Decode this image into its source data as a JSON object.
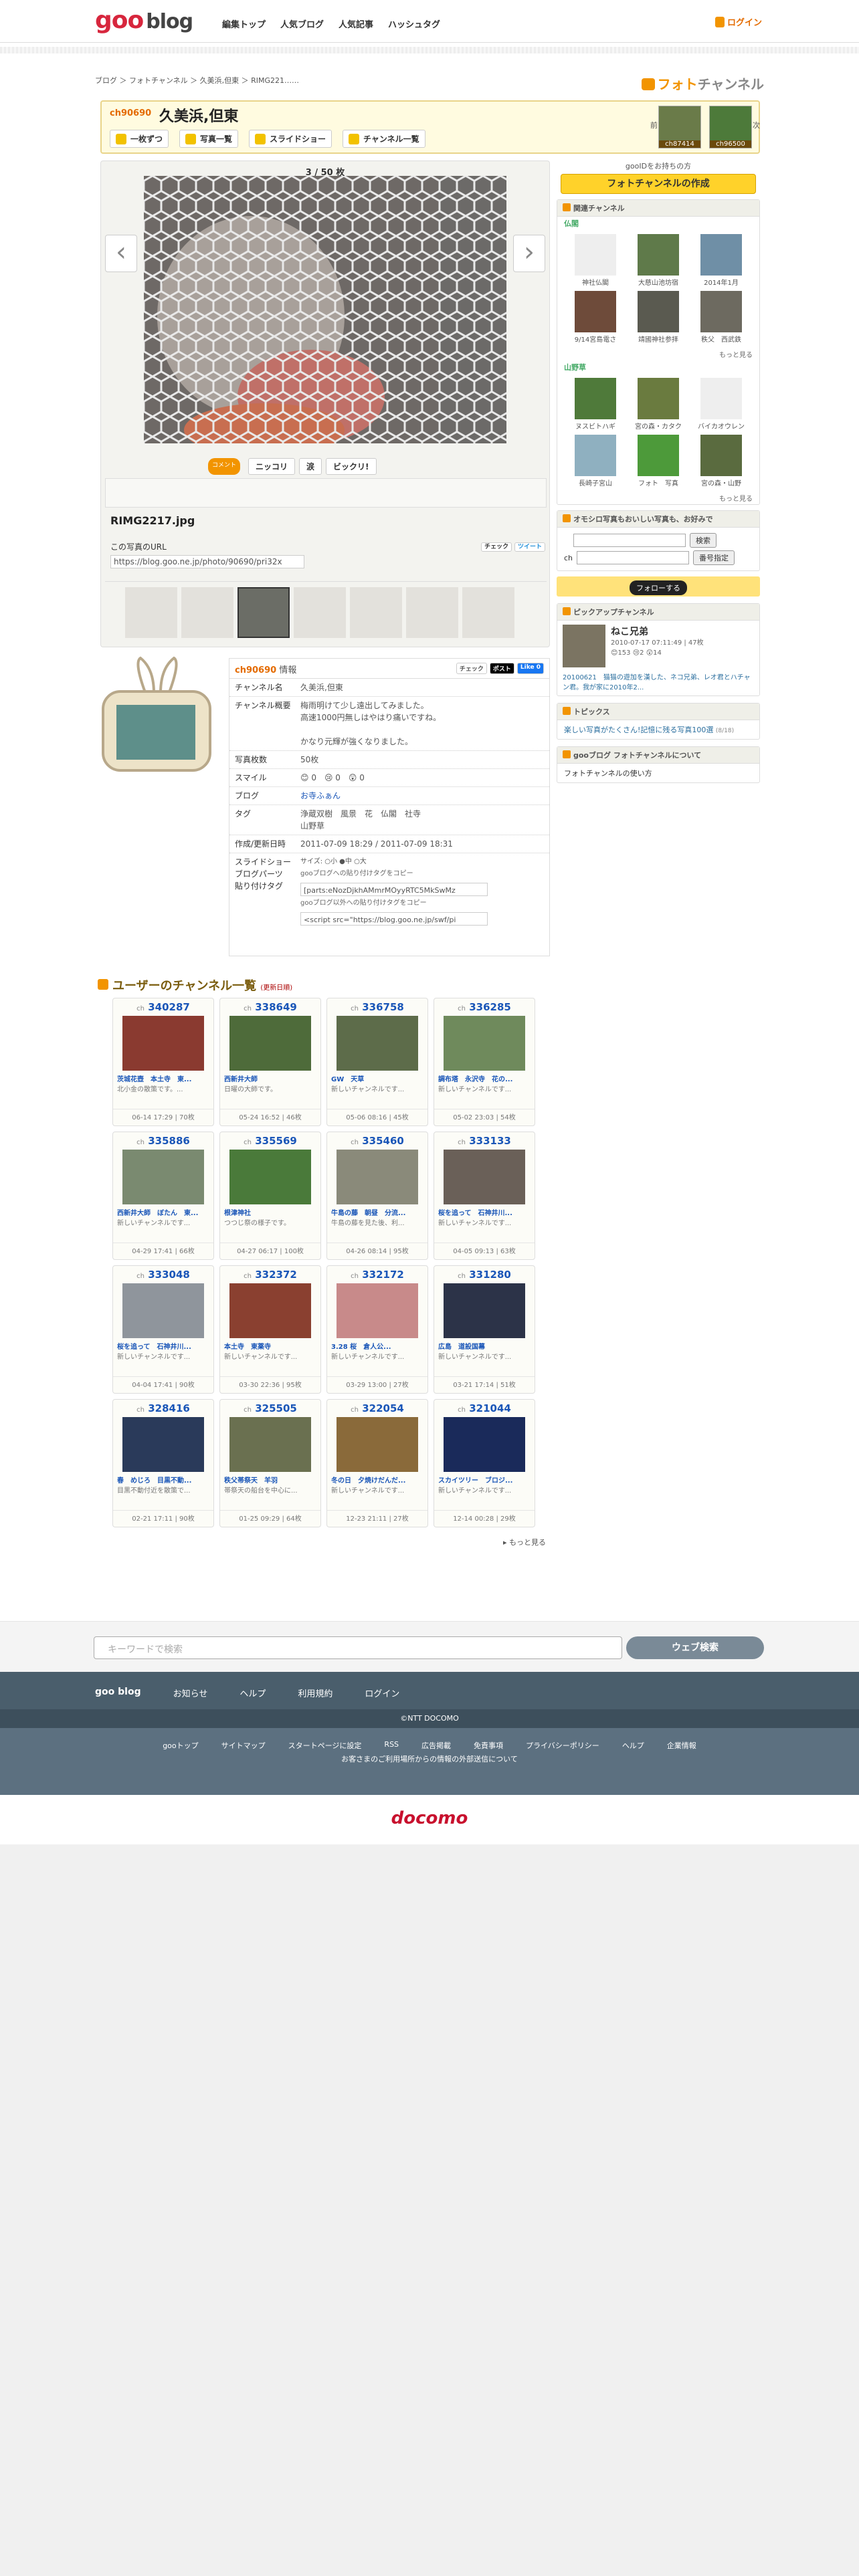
{
  "header": {
    "logo_goo": "goo",
    "logo_blog": "blog",
    "nav": [
      "編集トップ",
      "人気ブログ",
      "人気記事",
      "ハッシュタグ"
    ],
    "login": "ログイン"
  },
  "breadcrumb": "ブログ ＞ フォトチャンネル ＞ 久美浜,但東 ＞ RIMG221……",
  "brand": {
    "photo": "フォト",
    "channel": "チャンネル"
  },
  "channel": {
    "id": "ch90690",
    "name": "久美浜,但東",
    "buttons": [
      "一枚ずつ",
      "写真一覧",
      "スライドショー",
      "チャンネル一覧"
    ],
    "prev_label": "前",
    "next_label": "次",
    "prev_id": "ch87414",
    "next_id": "ch96500"
  },
  "viewer": {
    "counter": "3 / 50 枚",
    "filename": "RIMG2217.jpg",
    "url_label": "この写真のURL",
    "url": "https://blog.goo.ne.jp/photo/90690/pri32x",
    "check": "チェック",
    "tweet": "ツイート",
    "comment_tag": "コメント\nスタンプ",
    "reactions": [
      "ニッコリ",
      "涙",
      "ビックリ!"
    ]
  },
  "sidebar": {
    "hint": "gooIDをお持ちの方",
    "make": "フォトチャンネルの作成",
    "related_title": "関連チャンネル",
    "related_groups": [
      {
        "name": "仏閣",
        "items": [
          "神社仏閣",
          "大慈山池坊宿",
          "2014年1月",
          "9/14宮島電さ",
          "靖國神社参拝",
          "秩父　西武鉄"
        ]
      },
      {
        "name": "山野草",
        "items": [
          "ヌスビトハギ",
          "宮の森・カタク",
          "バイカオウレン",
          "長崎子宮山",
          "フォト　写真",
          "宮の森・山野"
        ]
      }
    ],
    "more": "もっと見る",
    "search_title": "オモシロ写真もおいしい写真も、お好みで",
    "search_btn": "検索",
    "number_btn": "番号指定",
    "ch": "ch",
    "follow": "フォローする",
    "pickup_title": "ピックアップチャンネル",
    "pickup": {
      "name": "ねこ兄弟",
      "date": "2010-07-17 07:11:49 | 47枚",
      "desc": "20100621　猫猫の遊加を漢した、ネコ兄弟、レオ君とハチャン君。我が家に2010年2...",
      "counts": [
        "153",
        "2",
        "14"
      ]
    },
    "topics_title": "トピックス",
    "topic": "楽しい写真がたくさん!記憶に残る写真100選",
    "topic_sub": "(8/18)",
    "about_title": "gooブログ フォトチャンネルについて",
    "about": "フォトチャンネルの使い方"
  },
  "info": {
    "id": "ch90690",
    "head": "情報",
    "check": "チェック",
    "post": "ポスト",
    "like": "Like 0",
    "rows": [
      {
        "k": "チャンネル名",
        "v": "久美浜,但東"
      },
      {
        "k": "チャンネル概要",
        "v": "梅雨明けて少し遠出してみました。\n高速1000円無しはやはり痛いですね。\n\nかなり元輝が強くなりました。"
      },
      {
        "k": "写真枚数",
        "v": "50枚"
      },
      {
        "k": "スマイル",
        "v": "😊 0　😢 0　😲 0"
      },
      {
        "k": "ブログ",
        "v": "お寺ふぁん"
      },
      {
        "k": "タグ",
        "v": "浄蔵双樹　風景　花　仏閣　社寺\n山野草"
      },
      {
        "k": "作成/更新日時",
        "v": "2011-07-09 18:29 / 2011-07-09 18:31"
      }
    ],
    "embed_label": "スライドショー ブログパーツ 貼り付けタグ",
    "size_label": "サイズ:",
    "sizes": [
      "小",
      "中",
      "大"
    ],
    "goo_copy": "gooブログへの貼り付けタグをコピー",
    "goo_tag": "[parts:eNozDjkhAMmrMOyyRTC5MkSwMz",
    "other_copy": "gooブログ以外への貼り付けタグをコピー",
    "other_tag": "<script src=\"https://blog.goo.ne.jp/swf/pi"
  },
  "user_list": {
    "title": "ユーザーのチャンネル一覧",
    "sub": "(更新日順)",
    "more": "もっと見る",
    "cards": [
      {
        "id": "340287",
        "title": "茨城花壺　本土寺　東...",
        "desc": "北小金の散策です。...",
        "foot": "06-14 17:29 | 70枚"
      },
      {
        "id": "338649",
        "title": "西新井大師",
        "desc": "日曜の大師です。",
        "foot": "05-24 16:52 | 46枚"
      },
      {
        "id": "336758",
        "title": "GW　天草",
        "desc": "新しいチャンネルです...",
        "foot": "05-06 08:16 | 45枚"
      },
      {
        "id": "336285",
        "title": "調布塔　永沢寺　花の...",
        "desc": "新しいチャンネルです...",
        "foot": "05-02 23:03 | 54枚"
      },
      {
        "id": "335886",
        "title": "西新井大師　ぼたん　東...",
        "desc": "新しいチャンネルです...",
        "foot": "04-29 17:41 | 66枚"
      },
      {
        "id": "335569",
        "title": "根津神社",
        "desc": "つつじ祭の様子です。",
        "foot": "04-27 06:17 | 100枚"
      },
      {
        "id": "335460",
        "title": "牛島の藤　朝昼　分流...",
        "desc": "牛島の藤を見た後、利...",
        "foot": "04-26 08:14 | 95枚"
      },
      {
        "id": "333133",
        "title": "桜を追って　石神井川...",
        "desc": "新しいチャンネルです...",
        "foot": "04-05 09:13 | 63枚"
      },
      {
        "id": "333048",
        "title": "桜を追って　石神井川...",
        "desc": "新しいチャンネルです...",
        "foot": "04-04 17:41 | 90枚"
      },
      {
        "id": "332372",
        "title": "本土寺　東薬寺",
        "desc": "新しいチャンネルです...",
        "foot": "03-30 22:36 | 95枚"
      },
      {
        "id": "332172",
        "title": "3.28 桜　倉人公...",
        "desc": "新しいチャンネルです...",
        "foot": "03-29 13:00 | 27枚"
      },
      {
        "id": "331280",
        "title": "広島　道設国幕",
        "desc": "新しいチャンネルです...",
        "foot": "03-21 17:14 | 51枚"
      },
      {
        "id": "328416",
        "title": "春　めじろ　目黒不動...",
        "desc": "目黒不動付近を散策で...",
        "foot": "02-21 17:11 | 90枚"
      },
      {
        "id": "325505",
        "title": "秩父帯祭天　羊羽",
        "desc": "帯祭天の船台を中心に...",
        "foot": "01-25 09:29 | 64枚"
      },
      {
        "id": "322054",
        "title": "冬の日　夕焼けだんだ...",
        "desc": "新しいチャンネルです...",
        "foot": "12-23 21:11 | 27枚"
      },
      {
        "id": "321044",
        "title": "スカイツリー　ブロジ...",
        "desc": "新しいチャンネルです...",
        "foot": "12-14 00:28 | 29枚"
      }
    ]
  },
  "footer": {
    "search_placeholder": "キーワードで検索",
    "web_search": "ウェブ検索",
    "brand": "goo blog",
    "links1": [
      "お知らせ",
      "ヘルプ",
      "利用規約",
      "ログイン"
    ],
    "copyright": "©NTT DOCOMO",
    "links2": [
      "gooトップ",
      "サイトマップ",
      "スタートページに設定",
      "RSS",
      "広告掲載",
      "免責事項",
      "プライバシーポリシー",
      "ヘルプ",
      "企業情報"
    ],
    "note": "お客さまのご利用場所からの情報の外部送信について",
    "docomo": "docomo"
  },
  "colors": {
    "accent": "#f29400",
    "link": "#1a56b8",
    "footer": "#5c7080"
  }
}
